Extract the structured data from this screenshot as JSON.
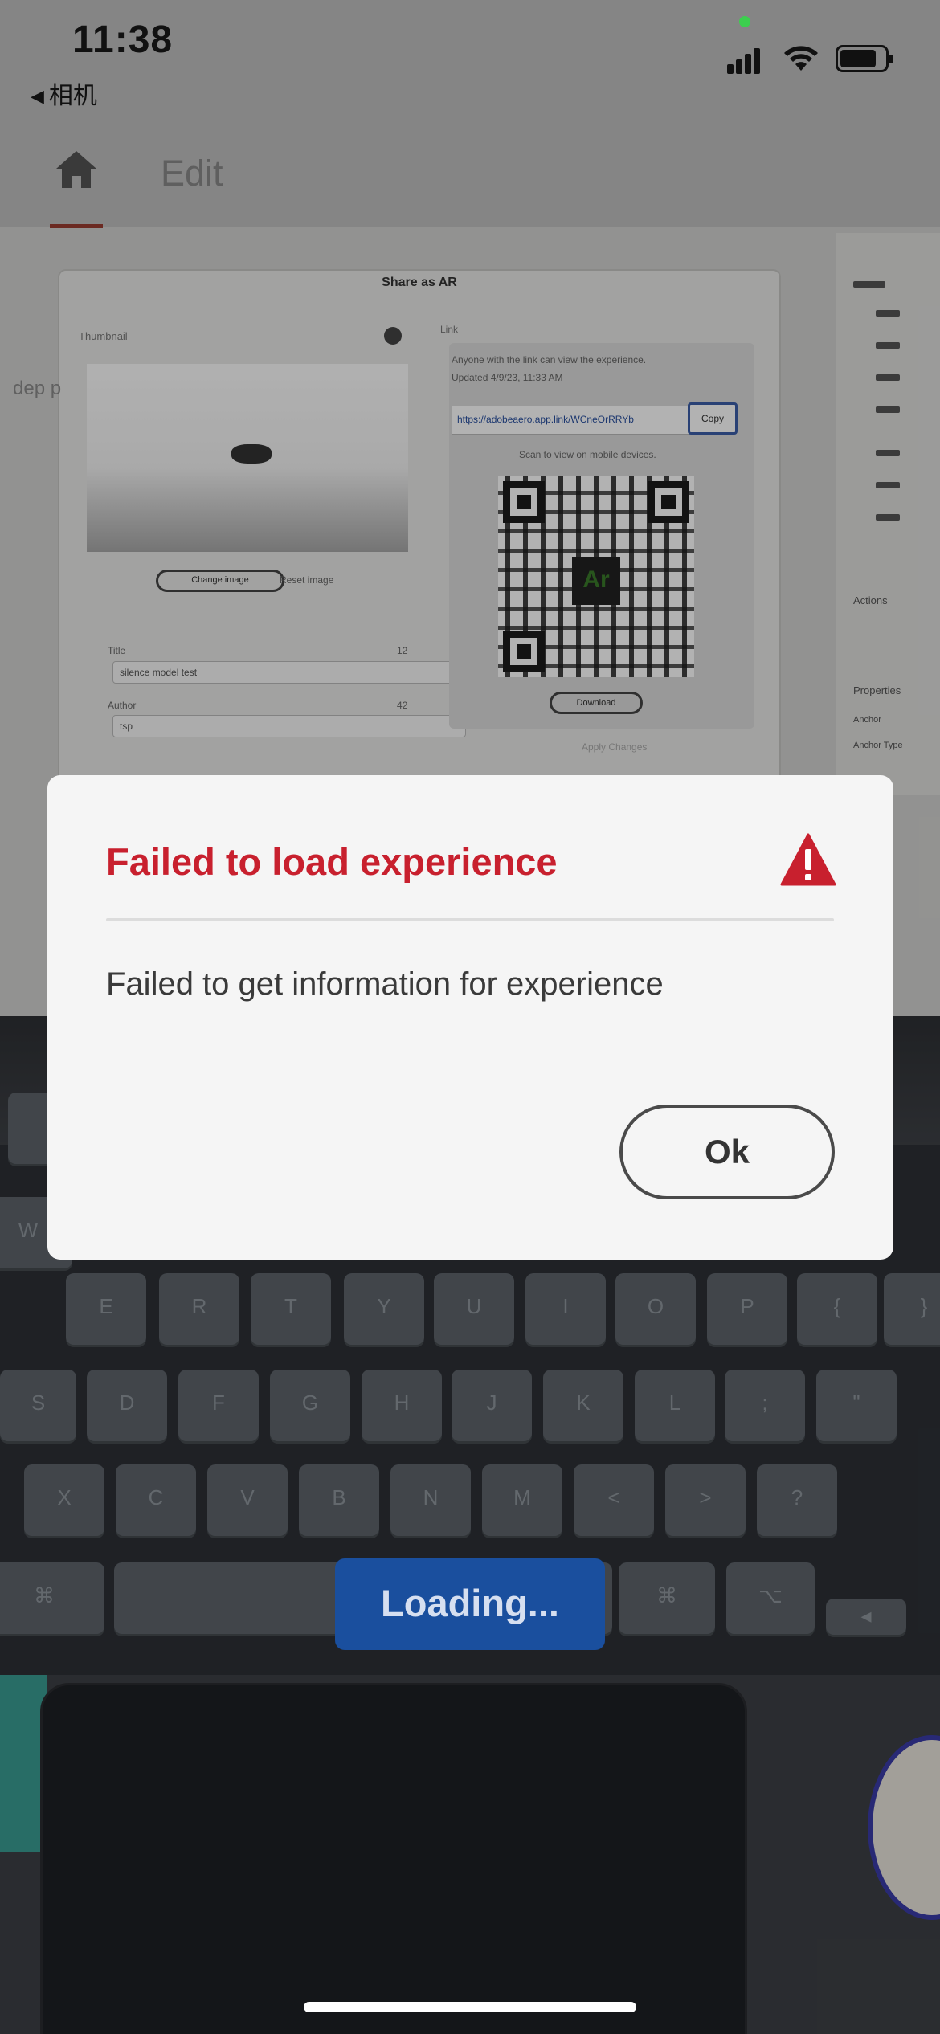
{
  "status_bar": {
    "time": "11:38",
    "back_app_label": "相机"
  },
  "header": {
    "home_icon": "home-icon",
    "edit_tab_label": "Edit"
  },
  "background_scene": {
    "window_title": "Share as AR",
    "thumbnail_label": "Thumbnail",
    "change_image_label": "Change image",
    "reset_image_label": "Reset image",
    "title_label": "Title",
    "title_count": "12",
    "title_value": "silence model test",
    "author_label": "Author",
    "author_count": "42",
    "author_value": "tsp",
    "link_label": "Link",
    "link_note": "Anyone with the link can view the experience.",
    "updated_text": "Updated 4/9/23, 11:33 AM",
    "url": "https://adobeaero.app.link/WCneOrRRYb",
    "copy_label": "Copy",
    "scan_text": "Scan to view on mobile devices.",
    "qr_badge": "Ar",
    "download_label": "Download",
    "apply_label": "Apply Changes",
    "left_text": "dep p",
    "panel_actions": "Actions",
    "panel_properties": "Properties",
    "panel_anchor": "Anchor",
    "panel_anchor_type": "Anchor Type"
  },
  "modal": {
    "title": "Failed to load experience",
    "icon": "warning-triangle-icon",
    "message": "Failed to get information for experience",
    "ok_label": "Ok",
    "title_color": "#c8202e"
  },
  "loading": {
    "label": "Loading...",
    "color": "#1a4f9e"
  }
}
